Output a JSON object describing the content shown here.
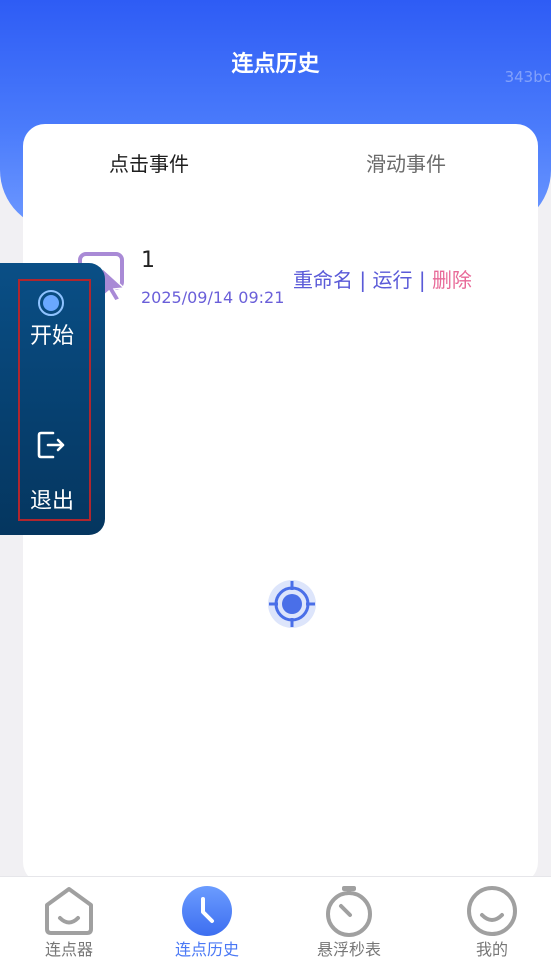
{
  "header": {
    "title": "连点历史",
    "watermark": "343bc"
  },
  "tabs": [
    {
      "label": "点击事件",
      "active": true
    },
    {
      "label": "滑动事件",
      "active": false
    }
  ],
  "records": [
    {
      "name": "1",
      "time": "2025/09/14 09:21",
      "icon": "click-cursor-icon",
      "actions": {
        "rename": "重命名",
        "run": "运行",
        "delete": "删除",
        "separator": "|"
      }
    }
  ],
  "float_panel": {
    "start_label": "开始",
    "exit_label": "退出"
  },
  "bottom_nav": [
    {
      "label": "连点器",
      "icon": "home-icon",
      "active": false
    },
    {
      "label": "连点历史",
      "icon": "clock-icon",
      "active": true
    },
    {
      "label": "悬浮秒表",
      "icon": "stopwatch-icon",
      "active": false
    },
    {
      "label": "我的",
      "icon": "smile-icon",
      "active": false
    }
  ],
  "colors": {
    "accent": "#4a78f5",
    "header_top": "#2e5cf5",
    "panel": "#063f6e",
    "delete": "#e86a98",
    "link": "#5a5ad8"
  }
}
